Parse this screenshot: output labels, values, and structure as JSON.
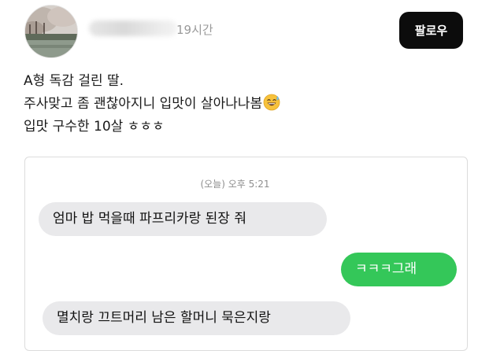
{
  "post": {
    "author": {
      "username": "",
      "timestamp": "19시간"
    },
    "follow_label": "팔로우",
    "lines": [
      "A형 독감 걸린 딸.",
      "주사맞고 좀 괜찮아지니 입맛이 살아나나봄",
      "입맛 구수한 10살 ㅎㅎㅎ"
    ],
    "emoji": "grinning-face-with-sweat"
  },
  "chat": {
    "date_label": "(오늘) 오후 5:21",
    "messages": [
      {
        "direction": "incoming",
        "text": "엄마 밥 먹을때 파프리카랑 된장 줘"
      },
      {
        "direction": "outgoing",
        "text": "ㅋㅋㅋ그래"
      },
      {
        "direction": "incoming",
        "text": "멸치랑 끄트머리 남은 할머니 묵은지랑"
      }
    ]
  },
  "colors": {
    "follow_button_bg": "#0c0c0c",
    "outgoing_bubble": "#34c759",
    "incoming_bubble": "#e9e9eb",
    "secondary_text": "#9a9a9a"
  }
}
